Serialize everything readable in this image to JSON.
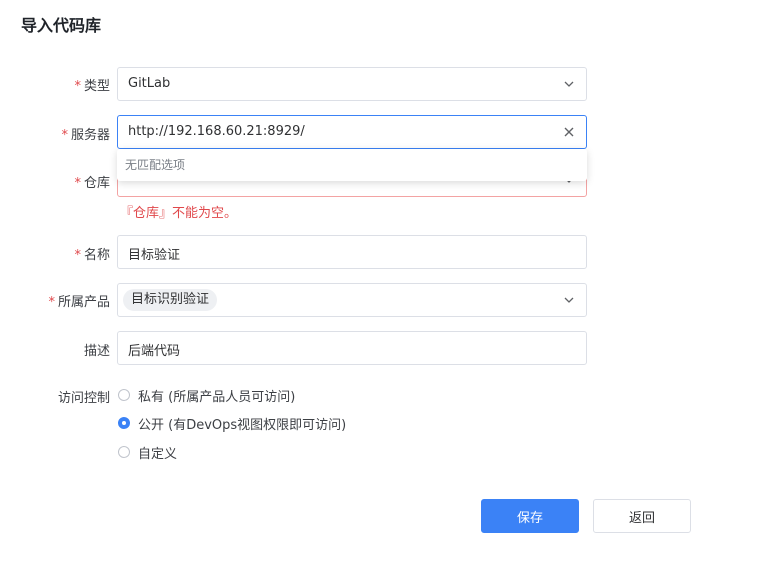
{
  "page": {
    "title": "导入代码库"
  },
  "form": {
    "type": {
      "label": "类型",
      "value": "GitLab"
    },
    "server": {
      "label": "服务器",
      "value": "http://192.168.60.21:8929/",
      "dropdown_empty": "无匹配选项"
    },
    "repo": {
      "label": "仓库",
      "error": "『仓库』不能为空。"
    },
    "name": {
      "label": "名称",
      "value": "目标验证"
    },
    "product": {
      "label": "所属产品",
      "tag": "目标识别验证"
    },
    "desc": {
      "label": "描述",
      "value": "后端代码"
    },
    "access": {
      "label": "访问控制",
      "options": [
        {
          "label": "私有 (所属产品人员可访问)",
          "checked": false
        },
        {
          "label": "公开 (有DevOps视图权限即可访问)",
          "checked": true
        },
        {
          "label": "自定义",
          "checked": false
        }
      ]
    }
  },
  "buttons": {
    "save": "保存",
    "back": "返回"
  },
  "colors": {
    "primary": "#3b82f6",
    "error": "#e0484b",
    "border": "#dcdfe6"
  },
  "icons": {
    "chevron": "chevron-down-icon",
    "clear": "close-icon"
  }
}
